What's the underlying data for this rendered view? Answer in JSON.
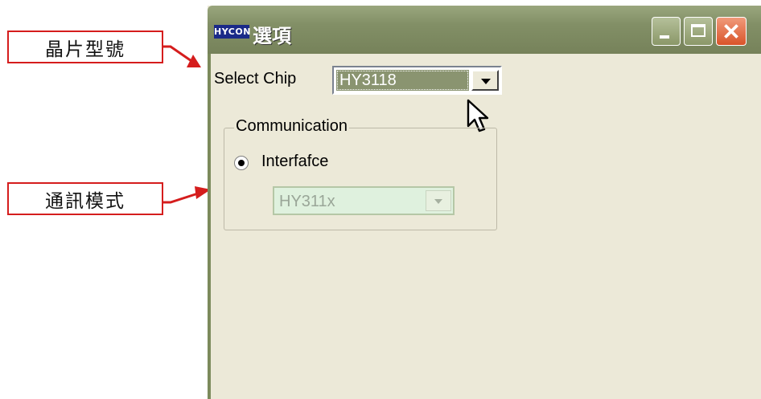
{
  "annotations": {
    "chip_model_label": "晶片型號",
    "communication_mode_label": "通訊模式",
    "accent_color": "#d51d1d"
  },
  "window": {
    "logo_text": "HYCON",
    "title": "選項",
    "titlebar_color": "#828f66",
    "controls": [
      "minimize-icon",
      "maximize-icon",
      "close-icon"
    ]
  },
  "form": {
    "select_chip_label": "Select Chip",
    "chip_value": "HY3118",
    "communication_group_label": "Communication",
    "interface_label": "Interfafce",
    "interface_selected": true,
    "interface_value": "HY311x"
  }
}
